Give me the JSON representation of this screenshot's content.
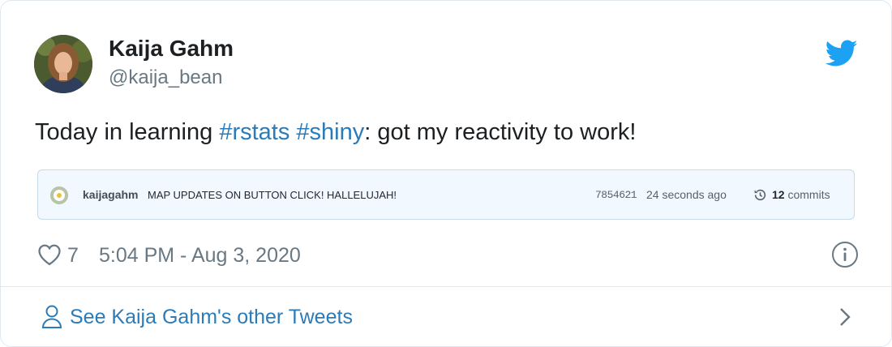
{
  "author": {
    "display_name": "Kaija Gahm",
    "handle": "@kaija_bean"
  },
  "tweet": {
    "text_before": "Today in learning ",
    "hashtag1": "#rstats",
    "space": " ",
    "hashtag2": "#shiny",
    "text_after": ": got my reactivity to work!"
  },
  "commit": {
    "author": "kaijagahm",
    "message": "MAP UPDATES ON BUTTON CLICK! HALLELUJAH!",
    "sha": "7854621",
    "time": "24 seconds ago",
    "count": "12",
    "count_suffix": " commits"
  },
  "meta": {
    "likes": "7",
    "timestamp": "5:04 PM - Aug 3, 2020"
  },
  "footer": {
    "link_text": "See Kaija Gahm's other Tweets"
  },
  "colors": {
    "link": "#2b7bb9",
    "twitter_blue": "#1da1f2",
    "muted": "#697882",
    "commit_bg": "#f1f8ff"
  },
  "icons": [
    "twitter-bird-icon",
    "history-icon",
    "heart-icon",
    "info-icon",
    "person-icon",
    "chevron-right-icon"
  ]
}
